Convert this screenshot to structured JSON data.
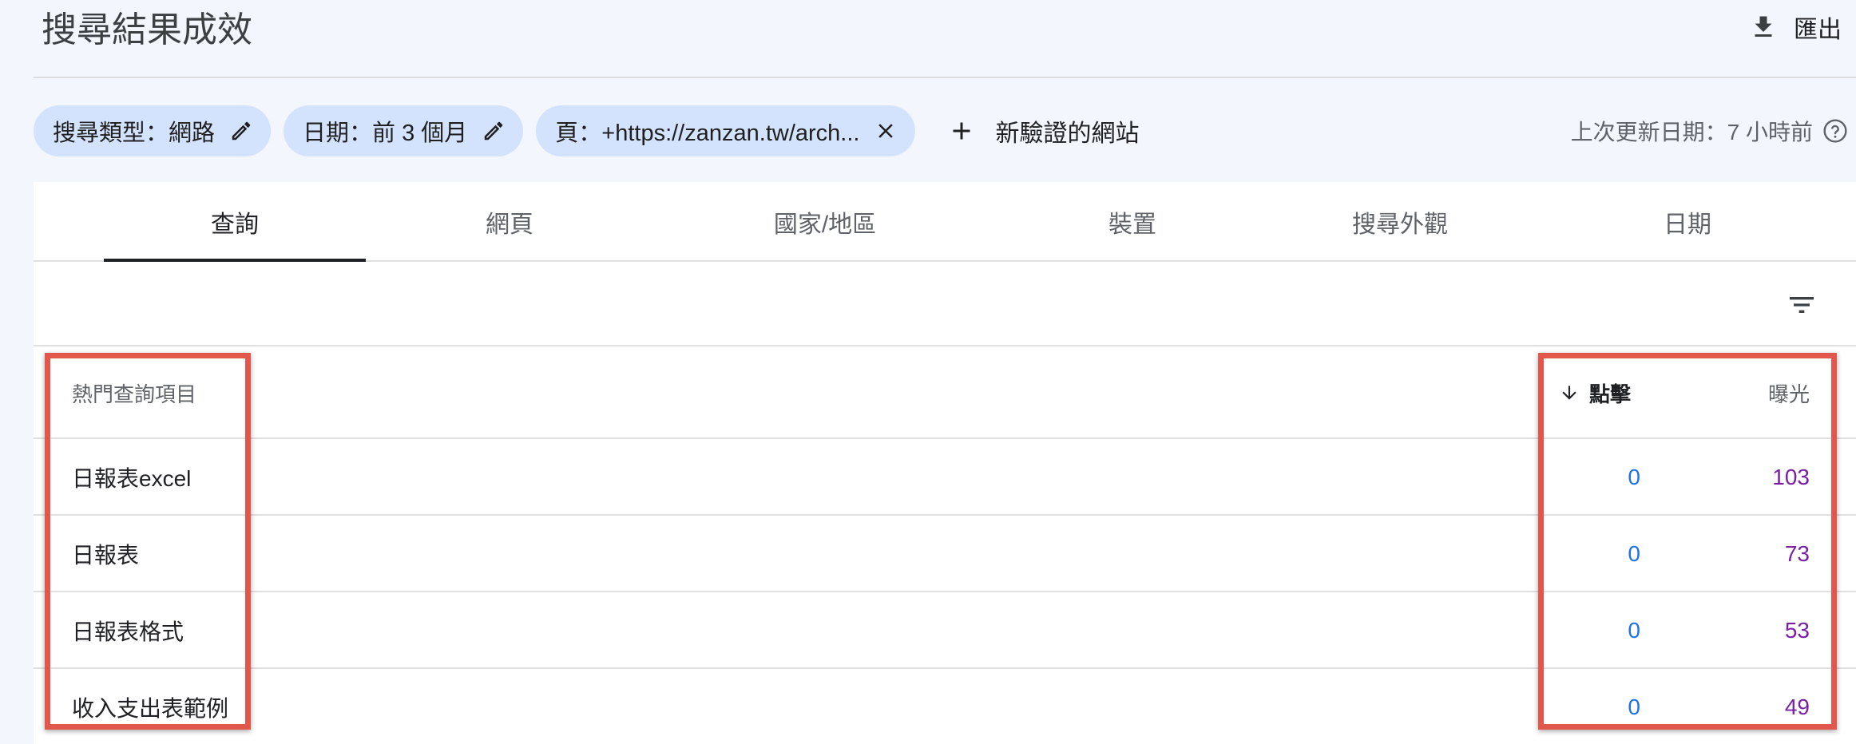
{
  "header": {
    "title": "搜尋結果成效",
    "export_label": "匯出"
  },
  "filters": {
    "chips": [
      {
        "label": "搜尋類型：網路",
        "action_icon": "pencil-icon"
      },
      {
        "label": "日期：前 3 個月",
        "action_icon": "pencil-icon"
      },
      {
        "label": "頁：+https://zanzan.tw/arch...",
        "action_icon": "close-icon"
      }
    ],
    "add_label": "新驗證的網站",
    "last_updated": "上次更新日期：7 小時前"
  },
  "tabs": [
    {
      "label": "查詢",
      "active": true
    },
    {
      "label": "網頁",
      "active": false
    },
    {
      "label": "國家/地區",
      "active": false
    },
    {
      "label": "裝置",
      "active": false
    },
    {
      "label": "搜尋外觀",
      "active": false
    },
    {
      "label": "日期",
      "active": false
    }
  ],
  "table": {
    "headers": {
      "query": "熱門查詢項目",
      "clicks": "點擊",
      "impressions": "曝光"
    },
    "rows": [
      {
        "query": "日報表excel",
        "clicks": "0",
        "impressions": "103"
      },
      {
        "query": "日報表",
        "clicks": "0",
        "impressions": "73"
      },
      {
        "query": "日報表格式",
        "clicks": "0",
        "impressions": "53"
      },
      {
        "query": "收入支出表範例",
        "clicks": "0",
        "impressions": "49"
      }
    ]
  },
  "colors": {
    "accent_blue": "#1a73e8",
    "accent_purple": "#7b1fa2",
    "chip_bg": "#d3e3fd",
    "highlight_red": "#e2574c"
  }
}
